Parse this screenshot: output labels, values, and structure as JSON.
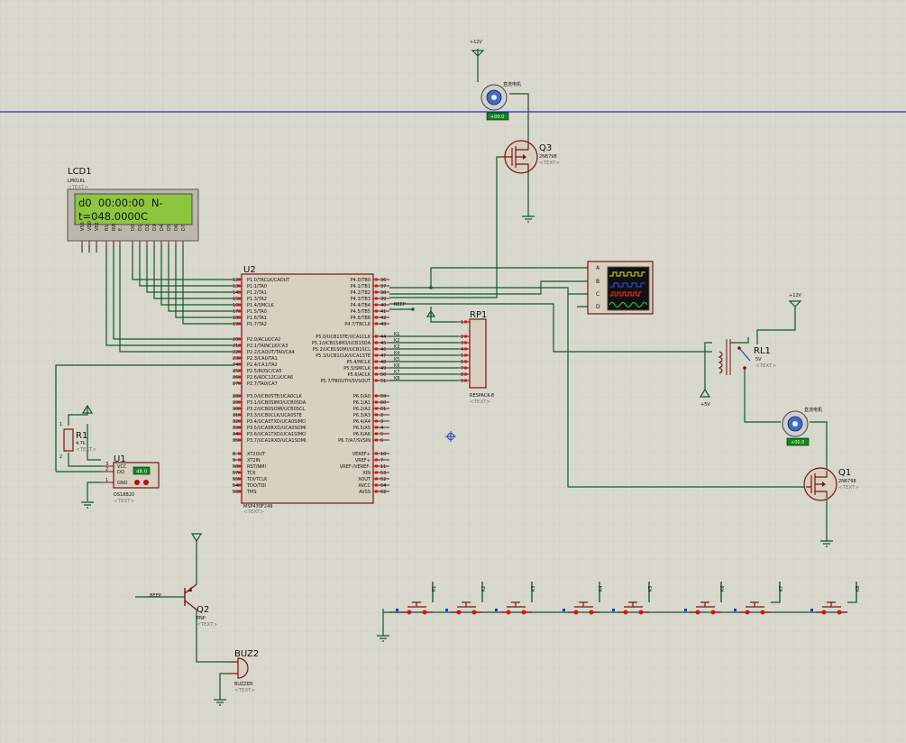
{
  "colors": {
    "background": "#d8d8cc",
    "grid": "#c6c6ba",
    "wire": "#0e5a2a",
    "part_outline": "#7a1414",
    "part_fill": "#d8d0c0",
    "lcd_screen": "#8cc63f",
    "pin_marker_red": "#e01010",
    "pin_marker_blue": "#2030e0",
    "crosshair": "#0000c8"
  },
  "lcd": {
    "ref": "LCD1",
    "part": "LM016L",
    "text_tag": "<TEXT>",
    "line1": "d0  00:00:00  N-",
    "line2": "t=048.0000C",
    "pins": [
      "VSS",
      "VDD",
      "VEE",
      "RS",
      "RW",
      "E",
      "D0",
      "D1",
      "D2",
      "D3",
      "D4",
      "D5",
      "D6",
      "D7"
    ]
  },
  "mcu": {
    "ref": "U2",
    "part": "MSP430F249",
    "text_tag": "<TEXT>",
    "left_pins": [
      {
        "num": "12",
        "name": "P1.0/TACLK/CAOUT"
      },
      {
        "num": "13",
        "name": "P1.1/TA0"
      },
      {
        "num": "14",
        "name": "P1.2/TA1"
      },
      {
        "num": "15",
        "name": "P1.3/TA2"
      },
      {
        "num": "16",
        "name": "P1.4/SMCLK"
      },
      {
        "num": "17",
        "name": "P1.5/TA0"
      },
      {
        "num": "18",
        "name": "P1.6/TA1"
      },
      {
        "num": "19",
        "name": "P1.7/TA2"
      },
      {
        "num": "20",
        "name": "P2.0/ACLK/CA2"
      },
      {
        "num": "21",
        "name": "P2.1/TAINCLK/CA3"
      },
      {
        "num": "22",
        "name": "P2.2/CAOUT/TA0/CA4"
      },
      {
        "num": "23",
        "name": "P2.3/CA0/TA1"
      },
      {
        "num": "24",
        "name": "P2.4/CA1/TA2"
      },
      {
        "num": "25",
        "name": "P2.5/ROSC/CA5"
      },
      {
        "num": "26",
        "name": "P2.6/ADC12CLK/CA6"
      },
      {
        "num": "27",
        "name": "P2.7/TA0/CA7"
      },
      {
        "num": "28",
        "name": "P3.0/UCB0STE/UCA0CLK"
      },
      {
        "num": "29",
        "name": "P3.1/UCB0SIMO/UCB0SDA"
      },
      {
        "num": "30",
        "name": "P3.2/UCB0SOMI/UCB0SCL"
      },
      {
        "num": "31",
        "name": "P3.3/UCB0CLK/UCA0STE"
      },
      {
        "num": "32",
        "name": "P3.4/UCA0TXD/UCA0SIMO"
      },
      {
        "num": "33",
        "name": "P3.5/UCA0RXD/UCA0SOMI"
      },
      {
        "num": "34",
        "name": "P3.6/UCA1TXD/UCA1SIMO"
      },
      {
        "num": "35",
        "name": "P3.7/UCA1RXD/UCA1SOMI"
      },
      {
        "num": "8",
        "name": "XT2OUT"
      },
      {
        "num": "9",
        "name": "XT2IN"
      },
      {
        "num": "58",
        "name": "RST/NMI"
      },
      {
        "num": "57",
        "name": "TCK"
      },
      {
        "num": "55",
        "name": "TDI/TCLK"
      },
      {
        "num": "54",
        "name": "TDO/TDI"
      },
      {
        "num": "56",
        "name": "TMS"
      }
    ],
    "right_pins": [
      {
        "num": "36",
        "name": "P4.0/TB0"
      },
      {
        "num": "37",
        "name": "P4.1/TB1"
      },
      {
        "num": "38",
        "name": "P4.2/TB2"
      },
      {
        "num": "39",
        "name": "P4.3/TB3"
      },
      {
        "num": "40",
        "name": "P4.4/TB4"
      },
      {
        "num": "41",
        "name": "P4.5/TB5"
      },
      {
        "num": "42",
        "name": "P4.6/TB6"
      },
      {
        "num": "43",
        "name": "P4.7/TBCLK"
      },
      {
        "num": "44",
        "name": "P5.0/UCB1STE/UCA1CLK"
      },
      {
        "num": "45",
        "name": "P5.1/UCB1SIMO/UCB1SDA"
      },
      {
        "num": "46",
        "name": "P5.2/UCB1SOMI/UCB1SCL"
      },
      {
        "num": "47",
        "name": "P5.3/UCB1CLK/UCA1STE"
      },
      {
        "num": "48",
        "name": "P5.4/MCLK"
      },
      {
        "num": "49",
        "name": "P5.5/SMCLK"
      },
      {
        "num": "50",
        "name": "P5.6/ACLK"
      },
      {
        "num": "51",
        "name": "P5.7/TBOUTH/SVSOUT"
      },
      {
        "num": "59",
        "name": "P6.0/A0"
      },
      {
        "num": "60",
        "name": "P6.1/A1"
      },
      {
        "num": "61",
        "name": "P6.2/A2"
      },
      {
        "num": "2",
        "name": "P6.3/A3"
      },
      {
        "num": "3",
        "name": "P6.4/A4"
      },
      {
        "num": "4",
        "name": "P6.5/A5"
      },
      {
        "num": "5",
        "name": "P6.6/A6"
      },
      {
        "num": "6",
        "name": "P6.7/A7/SVSIN"
      },
      {
        "num": "10",
        "name": "VEREF+"
      },
      {
        "num": "7",
        "name": "VREF+"
      },
      {
        "num": "11",
        "name": "VREF-/VEREF-"
      },
      {
        "num": "53",
        "name": "XIN"
      },
      {
        "num": "52",
        "name": "XOUT"
      },
      {
        "num": "64",
        "name": "AVCC"
      },
      {
        "num": "62",
        "name": "AVSS"
      }
    ]
  },
  "rpack": {
    "ref": "RP1",
    "part": "RESPACK-8",
    "text_tag": "<TEXT>",
    "pins": [
      "1",
      "2",
      "3",
      "4",
      "5",
      "6",
      "7",
      "8",
      "9"
    ]
  },
  "key_nets": [
    "K1",
    "K2",
    "K3",
    "K4",
    "K5",
    "K6",
    "K7",
    "K8"
  ],
  "beep_net": "BEEP",
  "supply": {
    "v12a": "+12V",
    "v12b": "+12V",
    "v5": "+5V"
  },
  "motor_label": "直流电机",
  "motor_readout": "+00.0",
  "relay": {
    "ref": "RL1",
    "value": "5V",
    "text_tag": "<TEXT>"
  },
  "mosfets": [
    {
      "ref": "Q3",
      "part": "2N6798",
      "text_tag": "<TEXT>"
    },
    {
      "ref": "Q1",
      "part": "2N6798",
      "text_tag": "<TEXT>"
    }
  ],
  "bjt": {
    "ref": "Q2",
    "part": "PNP",
    "text_tag": "<TEXT>"
  },
  "buzzer": {
    "ref": "BUZ2",
    "part": "BUZZER",
    "text_tag": "<TEXT>"
  },
  "resistor": {
    "ref": "R1",
    "value": "4.7k",
    "text_tag": "<TEXT>",
    "pin_a": "1",
    "pin_b": "2"
  },
  "sensor": {
    "ref": "U1",
    "part": "DS18B20",
    "readout": "48.0",
    "pins": [
      {
        "num": "3",
        "name": "VCC"
      },
      {
        "num": "2",
        "name": "DQ"
      },
      {
        "num": "1",
        "name": "GND"
      }
    ]
  },
  "scope_channels": [
    "A",
    "B",
    "C",
    "D"
  ]
}
